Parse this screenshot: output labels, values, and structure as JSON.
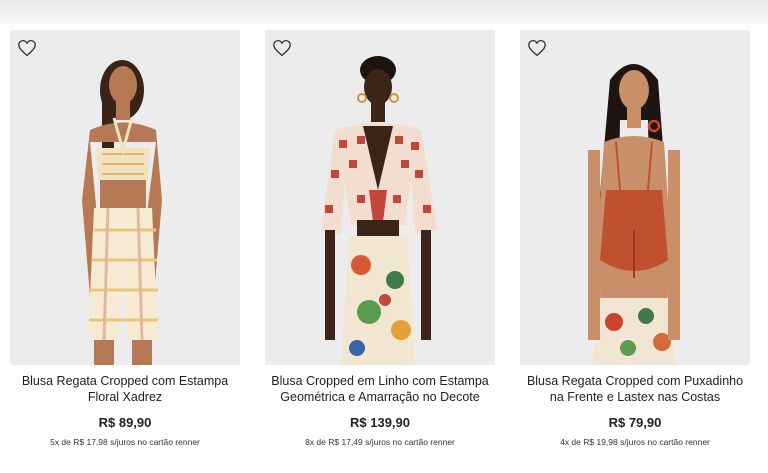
{
  "products": [
    {
      "name": "Blusa Regata Cropped com Estampa Floral Xadrez",
      "price": "R$ 89,90",
      "installments": "5x de R$ 17,98 s/juros no cartão renner"
    },
    {
      "name": "Blusa Cropped em Linho com Estampa Geométrica e Amarração no Decote",
      "price": "R$ 139,90",
      "installments": "8x de R$ 17,49 s/juros no cartão renner"
    },
    {
      "name": "Blusa Regata Cropped com Puxadinho na Frente e Lastex nas Costas",
      "price": "R$ 79,90",
      "installments": "4x de R$ 19,98 s/juros no cartão renner"
    }
  ],
  "icons": {
    "favorite": "heart-outline-icon"
  },
  "colors": {
    "photo_background": "#ebebeb",
    "text": "#222222"
  }
}
